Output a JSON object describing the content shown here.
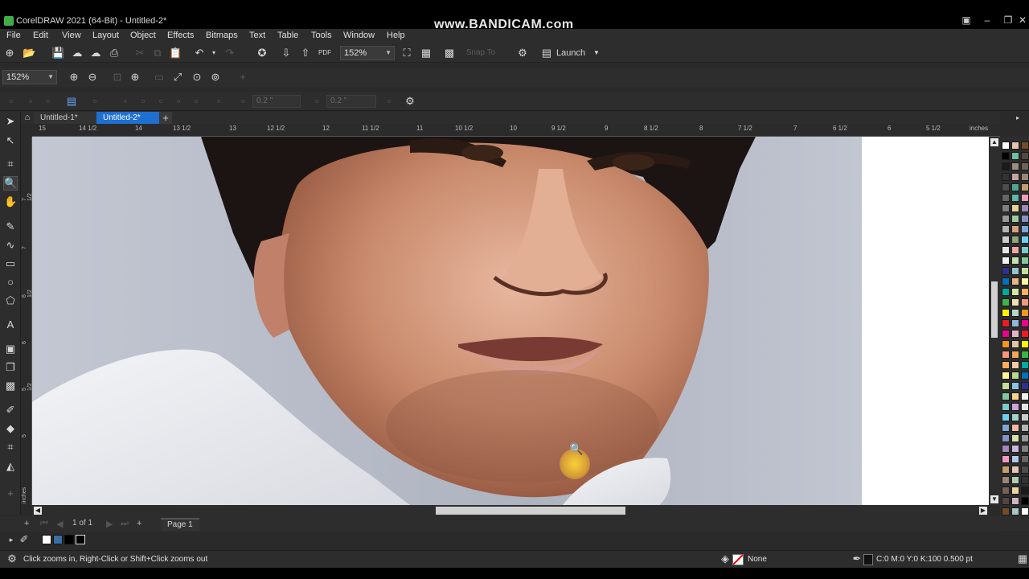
{
  "window": {
    "title": "CorelDRAW 2021 (64-Bit) - Untitled-2*",
    "watermark": "www.BANDICAM.com"
  },
  "menu": [
    "File",
    "Edit",
    "View",
    "Layout",
    "Object",
    "Effects",
    "Bitmaps",
    "Text",
    "Table",
    "Tools",
    "Window",
    "Help"
  ],
  "toolbar": {
    "zoom_level": "152%",
    "snap_to": "Snap To",
    "launch": "Launch"
  },
  "zoom_toolbar": {
    "zoom_level": "152%"
  },
  "property_bar": {
    "outline_width_1": "0.2 \"",
    "outline_width_2": "0.2 \""
  },
  "tabs": [
    {
      "label": "Untitled-1*",
      "active": false
    },
    {
      "label": "Untitled-2*",
      "active": true
    }
  ],
  "ruler": {
    "unit": "inches",
    "labels": [
      "15",
      "14 1/2",
      "14",
      "13 1/2",
      "13",
      "12 1/2",
      "12",
      "11 1/2",
      "11",
      "10 1/2",
      "10",
      "9 1/2",
      "9",
      "8 1/2",
      "8",
      "7 1/2",
      "7",
      "6 1/2",
      "6",
      "5 1/2"
    ],
    "vertical_labels": [
      "7 1/2",
      "7",
      "6 1/2",
      "6",
      "5 1/2",
      "5"
    ]
  },
  "page_nav": {
    "page_count": "1 of 1",
    "page_tab": "Page 1"
  },
  "status": {
    "hint": "Click zooms in, Right-Click or Shift+Click zooms out",
    "fill": "None",
    "outline": "C:0 M:0 Y:0 K:100  0.500 pt"
  },
  "palette_colors": [
    "#ffffff",
    "#000000",
    "#1a1a1a",
    "#333333",
    "#4d4d4d",
    "#666666",
    "#808080",
    "#999999",
    "#b3b3b3",
    "#cccccc",
    "#e6e6e6",
    "#f2f2f2",
    "#2e3192",
    "#0071bc",
    "#00a99d",
    "#39b54a",
    "#fff200",
    "#ed1c24",
    "#ec008c",
    "#f7941d",
    "#f7977a",
    "#fbaf5d",
    "#fff799",
    "#c4df9b",
    "#82ca9c",
    "#7accc8",
    "#6dcff6",
    "#7da7d9",
    "#8393ca",
    "#a187be",
    "#f49ac1",
    "#c69c6d",
    "#998675",
    "#736357",
    "#534741",
    "#754c24"
  ],
  "palette_colors_2": [
    "#e8c3b0",
    "#6fbfa0",
    "#9c8e7e",
    "#c2a5a2",
    "#4ea88f",
    "#5cb8a9",
    "#e7d190",
    "#a0c9a0",
    "#d6a27c",
    "#8da57a",
    "#efa6a6",
    "#c4e1ad",
    "#96c5c9",
    "#e8b77f",
    "#d5e6a0",
    "#f1e1b0",
    "#b5d7c3",
    "#8fb8d7",
    "#e3b4c9",
    "#dcc8a5",
    "#f2a65a",
    "#f7c9a1",
    "#b4d98b",
    "#88c4e2",
    "#f8d48a",
    "#cda4de",
    "#a3d2ca",
    "#f5b8a5",
    "#d9e3a8",
    "#c9b7df",
    "#b1c9e6",
    "#e4c8b8",
    "#afcfb0",
    "#ecd3a0",
    "#d0b5c3",
    "#aac4c8"
  ],
  "doc_palette": [
    "#ffffff",
    "#3a6ea5",
    "#000000",
    "#000000"
  ]
}
